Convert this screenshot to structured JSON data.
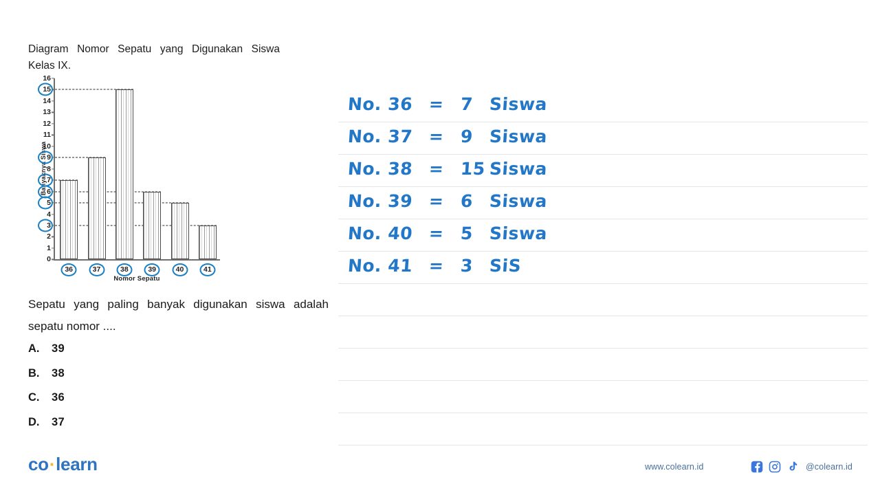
{
  "problem": {
    "heading": "Diagram Nomor Sepatu yang Digunakan Siswa Kelas IX.",
    "prompt": "Sepatu yang paling banyak digunakan siswa adalah sepatu nomor ....",
    "options": [
      {
        "key": "A.",
        "value": "39"
      },
      {
        "key": "B.",
        "value": "38"
      },
      {
        "key": "C.",
        "value": "36"
      },
      {
        "key": "D.",
        "value": "37"
      }
    ]
  },
  "chart_data": {
    "type": "bar",
    "title": "Diagram Nomor Sepatu yang Digunakan Siswa Kelas IX.",
    "xlabel": "Nomor Sepatu",
    "ylabel": "Banyaknya Siswa",
    "categories": [
      "36",
      "37",
      "38",
      "39",
      "40",
      "41"
    ],
    "values": [
      7,
      9,
      15,
      6,
      5,
      3
    ],
    "ylim": [
      0,
      16
    ],
    "yticks": [
      0,
      1,
      2,
      3,
      4,
      5,
      6,
      7,
      8,
      9,
      10,
      11,
      12,
      13,
      14,
      15,
      16
    ],
    "highlighted_yticks": [
      3,
      5,
      6,
      7,
      9,
      15
    ],
    "grid": false,
    "leader_lines": true,
    "legend": "none",
    "annotation_color": "#1a7fc4",
    "bar_fill": "hatched-vertical"
  },
  "worksheet": {
    "lines": [
      {
        "label": "No. 36",
        "eq": "=",
        "count": "7",
        "unit": "Siswa"
      },
      {
        "label": "No. 37",
        "eq": "=",
        "count": "9",
        "unit": "Siswa"
      },
      {
        "label": "No. 38",
        "eq": "=",
        "count": "15",
        "unit": "Siswa"
      },
      {
        "label": "No. 39",
        "eq": "=",
        "count": "6",
        "unit": "Siswa"
      },
      {
        "label": "No. 40",
        "eq": "=",
        "count": "5",
        "unit": "Siswa"
      },
      {
        "label": "No. 41",
        "eq": "=",
        "count": "3",
        "unit": "SiS"
      }
    ]
  },
  "footer": {
    "logo_left": "co",
    "logo_dot": "·",
    "logo_right": "learn",
    "url": "www.colearn.id",
    "handle": "@colearn.id",
    "social": [
      "facebook-icon",
      "instagram-icon",
      "tiktok-icon"
    ]
  }
}
